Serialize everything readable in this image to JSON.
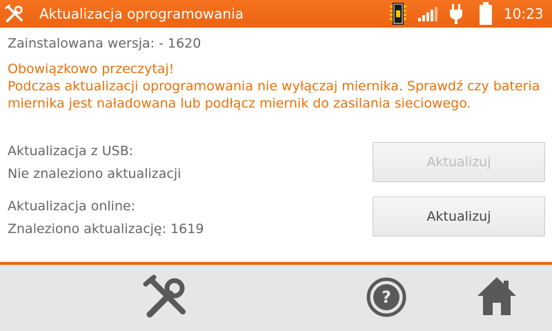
{
  "header": {
    "title": "Aktualizacja oprogramowania",
    "time": "10:23",
    "icons": [
      "tools-icon",
      "memory-card-icon",
      "signal-icon",
      "plug-icon",
      "battery-icon"
    ],
    "background_color": "#ec6512"
  },
  "content": {
    "installed_version": "Zainstalowana wersja: - 1620",
    "warning": [
      "Obowiązkowo przeczytaj!",
      "Podczas aktualizacji oprogramowania nie wyłączaj miernika. Sprawdź czy bateria miernika jest naładowana lub podłącz miernik do zasilania sieciowego."
    ],
    "usb": {
      "label": "Aktualizacja z USB:",
      "status": "Nie znaleziono aktualizacji",
      "button": "Aktualizuj",
      "button_enabled": false
    },
    "online": {
      "label": "Aktualizacja online:",
      "status": "Znaleziono aktualizację: 1619",
      "button": "Aktualizuj",
      "button_enabled": true
    }
  },
  "footer": {
    "icons": [
      "tools-icon",
      "help-icon",
      "home-icon"
    ]
  },
  "colors": {
    "accent": "#ec6512",
    "warning_text": "#e8720c",
    "body_text": "#666666",
    "footer_bg": "#e6e6e6",
    "footer_icon": "#595959"
  }
}
